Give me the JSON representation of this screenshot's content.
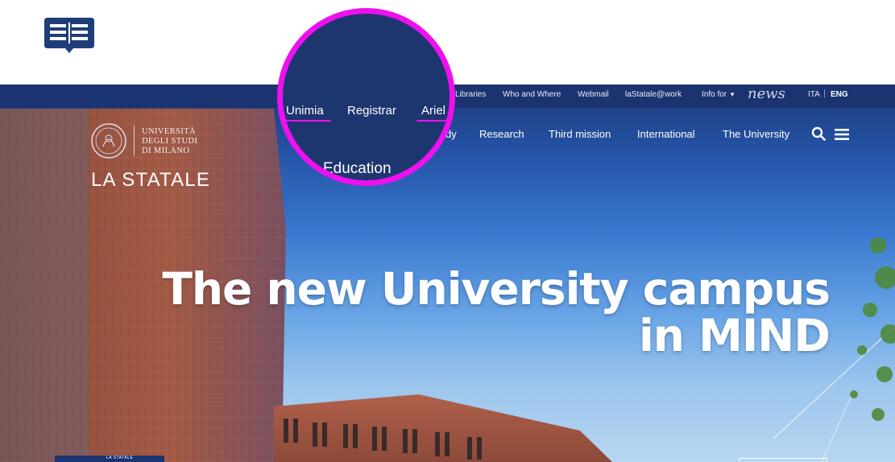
{
  "utility_nav": {
    "items": [
      {
        "label": "Libraries"
      },
      {
        "label": "Who and Where"
      },
      {
        "label": "Webmail"
      },
      {
        "label": "laStatale@work"
      },
      {
        "label": "Info for"
      }
    ],
    "news_label": "news",
    "languages": [
      "ITA",
      "ENG"
    ],
    "active_language": "ENG"
  },
  "logo": {
    "line1": "UNIVERSITÀ",
    "line2": "DEGLI STUDI",
    "line3": "DI MILANO",
    "wordmark": "LA STATALE"
  },
  "main_nav": {
    "items": [
      {
        "label": "dy"
      },
      {
        "label": "Research"
      },
      {
        "label": "Third mission"
      },
      {
        "label": "International"
      },
      {
        "label": "The University"
      }
    ]
  },
  "magnifier": {
    "items": [
      {
        "label": "Unimia"
      },
      {
        "label": "Registrar"
      },
      {
        "label": "Ariel"
      }
    ],
    "education_label": "Education"
  },
  "hero": {
    "headline_line1": "The new University campus",
    "headline_line2": "in MIND"
  },
  "badge": {
    "label": "LA STATALE"
  },
  "colors": {
    "nav_bar": "#1b3370",
    "magnifier_ring": "#ee10ee",
    "app_icon": "#1f3d78"
  },
  "icons": {
    "app": "book-reader-icon",
    "search": "search-icon",
    "menu": "hamburger-menu-icon",
    "dropdown": "caret-down-icon",
    "seal": "university-seal-icon"
  }
}
